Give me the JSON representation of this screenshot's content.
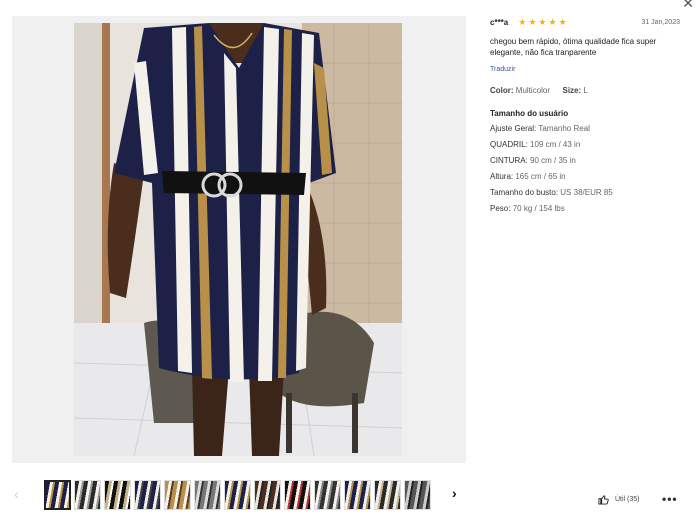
{
  "close": {
    "glyph": "✕"
  },
  "review": {
    "reviewer": "c***a",
    "rating": 5,
    "date": "31 Jan,2023",
    "text": "chegou bem rápido, ótima qualidade fica super elegante, não fica tranparente",
    "translate": "Traduzir",
    "color_label": "Color:",
    "color_value": "Multicolor",
    "size_label": "Size:",
    "size_value": "L"
  },
  "user_size": {
    "title": "Tamanho do usuário",
    "rows": [
      {
        "label": "Ajuste Geral:",
        "value": "Tamanho Real"
      },
      {
        "label": "QUADRIL:",
        "value": "109 cm / 43 in"
      },
      {
        "label": "CINTURA:",
        "value": "90 cm / 35 in"
      },
      {
        "label": "Altura:",
        "value": "165 cm / 65 in"
      },
      {
        "label": "Tamanho do busto:",
        "value": "US 38/EUR 85"
      },
      {
        "label": "Peso:",
        "value": "70 kg / 154 lbs"
      }
    ]
  },
  "footer": {
    "useful": "Útil (35)",
    "more": "•••"
  },
  "thumbnails": {
    "count": 13,
    "active_index": 0,
    "prev_glyph": "‹",
    "next_glyph": "›"
  },
  "colors": {
    "star": "#f7b500",
    "navy": "#1d2147",
    "gold": "#b8904a",
    "link": "#3b5998"
  }
}
